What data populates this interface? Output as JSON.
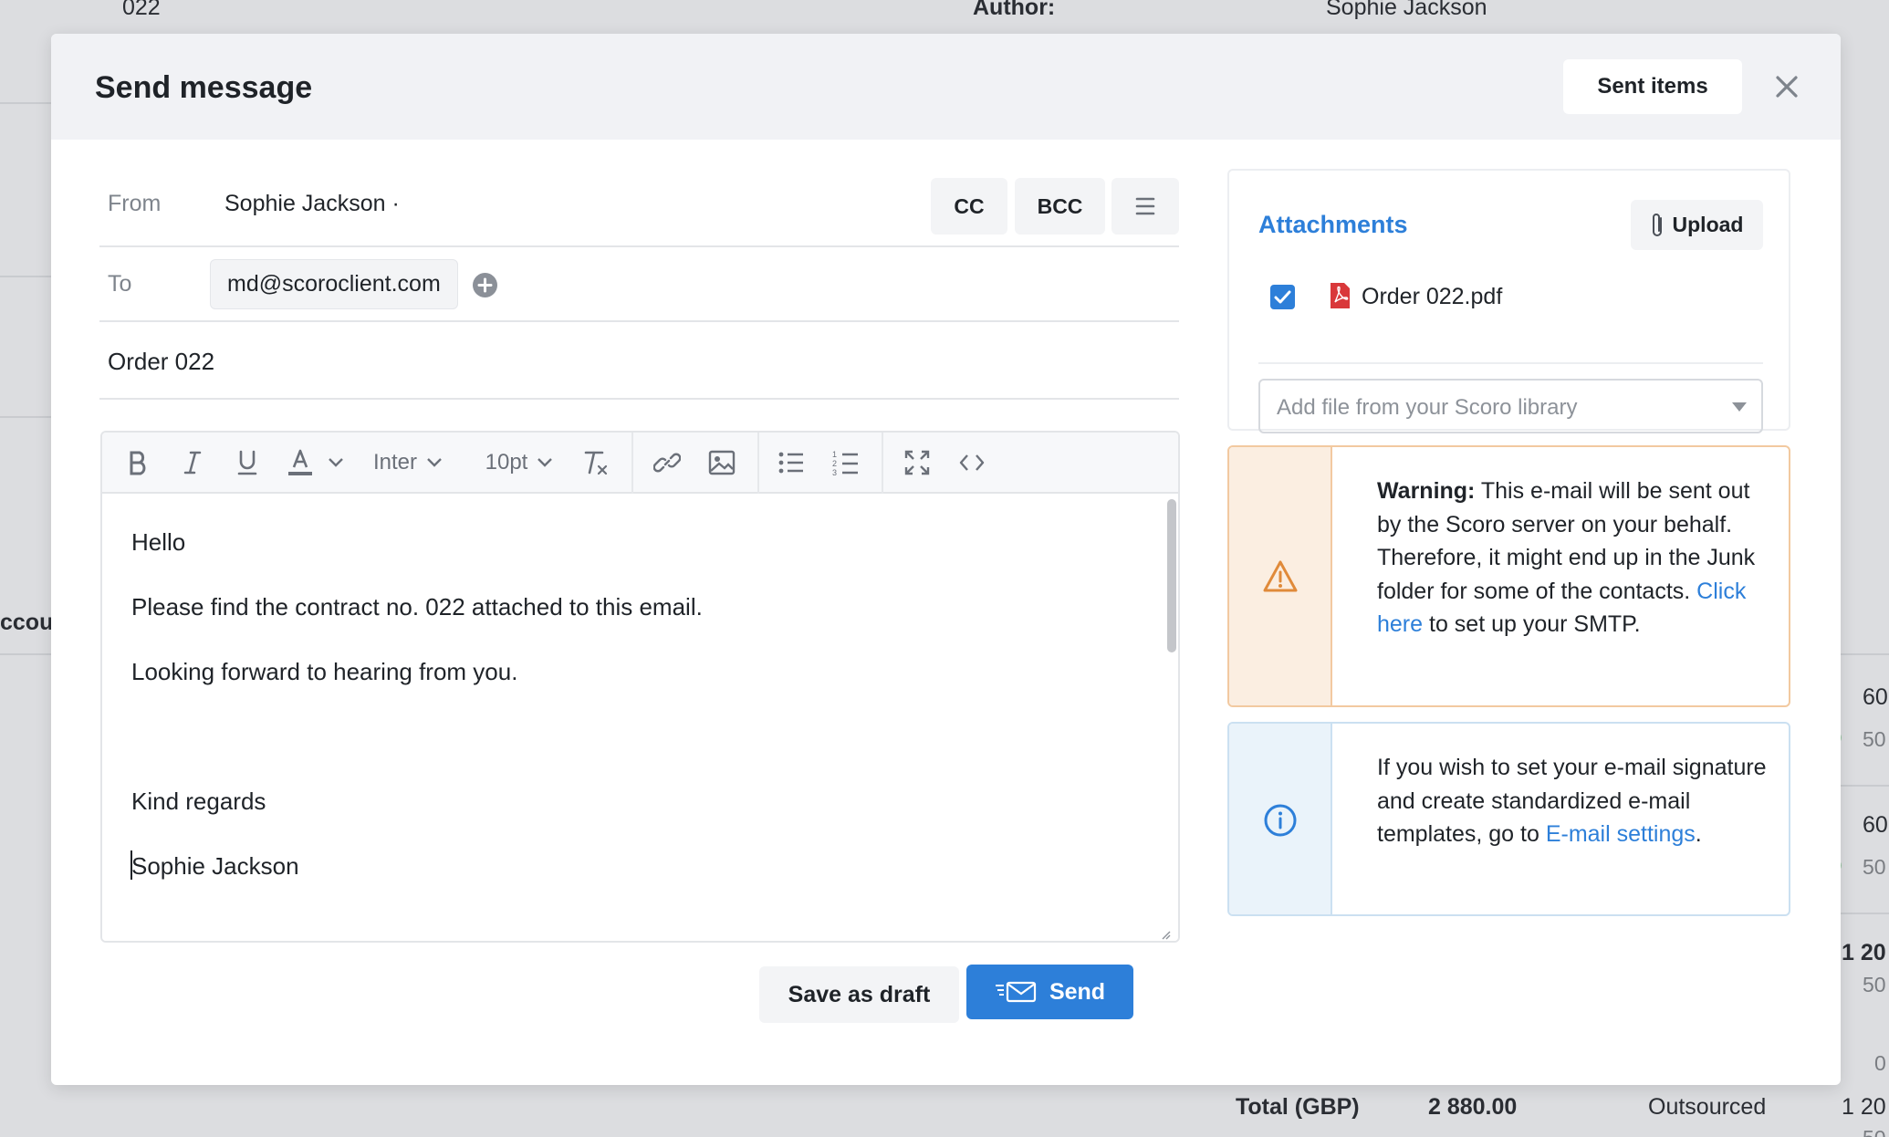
{
  "background": {
    "top_number": "022",
    "author_label": "Author:",
    "author_value": "Sophie Jackson",
    "account_fragment": "ccou",
    "right_values": [
      "60",
      "50",
      "60",
      "50",
      "1 20",
      "50",
      "0",
      "1 20",
      "50"
    ],
    "total_label": "Total (GBP)",
    "total_value": "2 880.00",
    "total_type": "Outsourced"
  },
  "modal": {
    "title": "Send message",
    "sent_items_label": "Sent items",
    "close_icon": "close-icon"
  },
  "form": {
    "from_label": "From",
    "from_value": "Sophie Jackson ·",
    "cc_label": "CC",
    "bcc_label": "BCC",
    "menu_icon": "hamburger-icon",
    "to_label": "To",
    "to_chip": "md@scoroclient.com",
    "add_recipient_icon": "plus-circle-icon",
    "subject": "Order 022"
  },
  "editor": {
    "toolbar": {
      "font_family": "Inter",
      "font_size": "10pt",
      "icons": [
        "bold-icon",
        "italic-icon",
        "underline-icon",
        "text-color-icon",
        "chevron-down-icon",
        "clear-format-icon",
        "link-icon",
        "image-icon",
        "bullet-list-icon",
        "numbered-list-icon",
        "fullscreen-icon",
        "code-icon"
      ]
    },
    "body_lines": [
      "Hello",
      "Please find the contract no. 022 attached to this email.",
      "Looking forward to hearing from you.",
      "Kind regards",
      "Sophie Jackson"
    ]
  },
  "actions": {
    "save_draft_label": "Save as draft",
    "send_label": "Send"
  },
  "attachments": {
    "title": "Attachments",
    "upload_label": "Upload",
    "files": [
      {
        "name": "Order 022.pdf",
        "checked": true
      }
    ],
    "library_placeholder": "Add file from your Scoro library"
  },
  "warning": {
    "bold": "Warning:",
    "text_before_link": " This e-mail will be sent out by the Scoro server on your behalf. Therefore, it might end up in the Junk folder for some of the contacts. ",
    "link": "Click here",
    "text_after_link": " to set up your SMTP."
  },
  "info": {
    "text_before_link": "If you wish to set your e-mail signature and create standardized e-mail templates, go to ",
    "link": "E-mail settings",
    "text_after_link": "."
  },
  "colors": {
    "accent": "#2d7fd9",
    "warning_border": "#f2c9a0",
    "warning_bg": "#fbeee1",
    "info_border": "#cbe0f1",
    "info_bg": "#eaf3fa"
  }
}
